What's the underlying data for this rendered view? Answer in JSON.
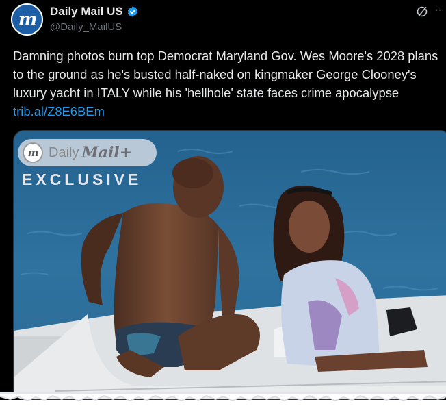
{
  "account": {
    "display_name": "Daily Mail US",
    "handle": "@Daily_MailUS",
    "avatar_letter": "m"
  },
  "tweet": {
    "text": "Damning photos burn top Democrat Maryland Gov. Wes Moore's 2028 plans to the ground as he's busted half-naked on kingmaker George Clooney's luxury yacht in ITALY while his 'hellhole' state faces crime apocalypse ",
    "link": "trib.al/Z8E6BEm"
  },
  "media": {
    "badge_logo_letter": "m",
    "badge_daily": "Daily",
    "badge_mail": "Mail+",
    "exclusive_label": "EXCLUSIVE"
  },
  "colors": {
    "background": "#000000",
    "text": "#e7e9ea",
    "secondary": "#71767b",
    "link": "#1d9bf0",
    "verified": "#1d9bf0",
    "sea": "#2f6f9f"
  },
  "icons": {
    "verified": "verified-badge-icon",
    "grok": "grok-icon",
    "more": "more-icon"
  }
}
